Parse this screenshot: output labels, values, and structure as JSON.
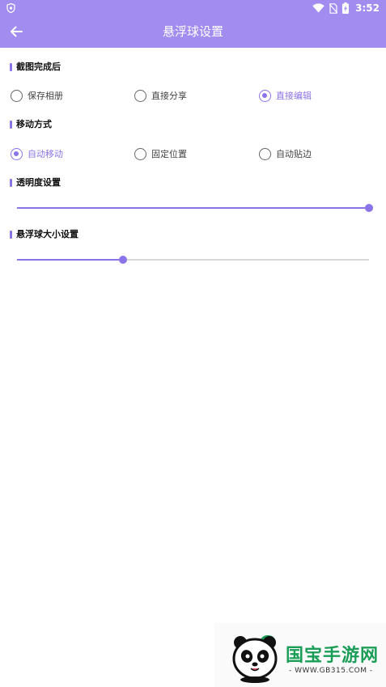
{
  "status_bar": {
    "time": "3:52"
  },
  "toolbar": {
    "title": "悬浮球设置"
  },
  "sections": {
    "capture": {
      "title": "截图完成后",
      "options": [
        {
          "label": "保存相册",
          "checked": false
        },
        {
          "label": "直接分享",
          "checked": false
        },
        {
          "label": "直接编辑",
          "checked": true
        }
      ]
    },
    "move": {
      "title": "移动方式",
      "options": [
        {
          "label": "自动移动",
          "checked": true
        },
        {
          "label": "固定位置",
          "checked": false
        },
        {
          "label": "自动贴边",
          "checked": false
        }
      ]
    },
    "opacity": {
      "title": "透明度设置",
      "value": 1.0
    },
    "size": {
      "title": "悬浮球大小设置",
      "value": 0.3
    }
  },
  "watermark": {
    "brand": "国宝手游网",
    "url": "- WWW.GB315.COM -"
  },
  "colors": {
    "accent": "#8b74e8",
    "header": "#a28cf0",
    "brand": "#1a9d57"
  }
}
